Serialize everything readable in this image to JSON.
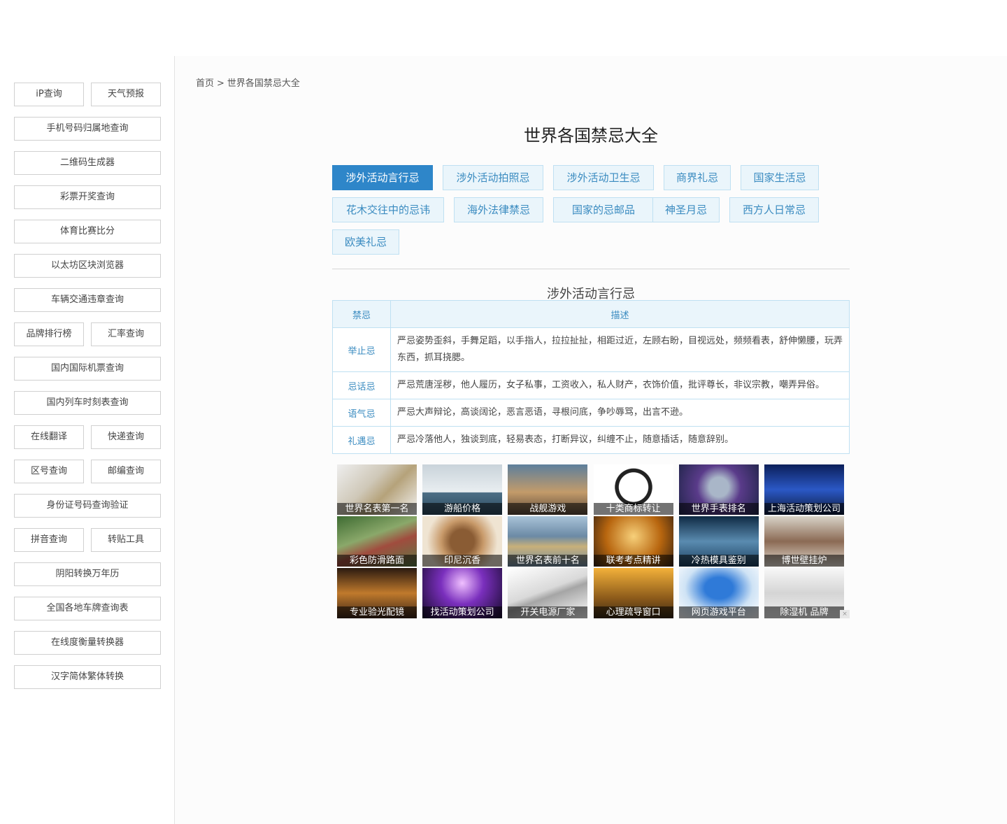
{
  "sidebar": {
    "rows": [
      [
        {
          "label": "iP查询"
        },
        {
          "label": "天气预报"
        }
      ],
      [
        {
          "label": "手机号码归属地查询"
        }
      ],
      [
        {
          "label": "二维码生成器"
        }
      ],
      [
        {
          "label": "彩票开奖查询"
        }
      ],
      [
        {
          "label": "体育比赛比分"
        }
      ],
      [
        {
          "label": "以太坊区块浏览器"
        }
      ],
      [
        {
          "label": "车辆交通违章查询"
        }
      ],
      [
        {
          "label": "品牌排行榜"
        },
        {
          "label": "汇率查询"
        }
      ],
      [
        {
          "label": "国内国际机票查询"
        }
      ],
      [
        {
          "label": "国内列车时刻表查询"
        }
      ],
      [
        {
          "label": "在线翻译"
        },
        {
          "label": "快递查询"
        }
      ],
      [
        {
          "label": "区号查询"
        },
        {
          "label": "邮编查询"
        }
      ],
      [
        {
          "label": "身份证号码查询验证"
        }
      ],
      [
        {
          "label": "拼音查询"
        },
        {
          "label": "转贴工具"
        }
      ],
      [
        {
          "label": "阴阳转换万年历"
        }
      ],
      [
        {
          "label": "全国各地车牌查询表"
        }
      ],
      [
        {
          "label": "在线度衡量转换器"
        }
      ],
      [
        {
          "label": "汉字简体繁体转换"
        }
      ]
    ]
  },
  "breadcrumb": {
    "home": "首页",
    "separator": ">",
    "current": "世界各国禁忌大全"
  },
  "page_title": "世界各国禁忌大全",
  "tags": [
    {
      "label": "涉外活动言行忌",
      "active": true
    },
    {
      "label": "涉外活动拍照忌"
    },
    {
      "label": "涉外活动卫生忌"
    },
    {
      "label": "商界礼忌"
    },
    {
      "label": "国家生活忌"
    },
    {
      "label": "花木交往中的忌讳"
    },
    {
      "label": "海外法律禁忌"
    },
    {
      "label": "国家的忌邮品"
    },
    {
      "label": "神圣月忌"
    },
    {
      "label": "西方人日常忌"
    },
    {
      "label": "欧美礼忌"
    }
  ],
  "section_title": "涉外活动言行忌",
  "table": {
    "headers": [
      "禁忌",
      "描述"
    ],
    "rows": [
      {
        "key": "举止忌",
        "desc": "严忌姿势歪斜，手舞足蹈，以手指人，拉拉扯扯，相距过近，左顾右盼，目视远处，频频看表，舒伸懒腰，玩弄东西，抓耳挠腮。"
      },
      {
        "key": "忌话忌",
        "desc": "严忌荒唐淫秽，他人履历，女子私事，工资收入，私人财产，衣饰价值，批评尊长，非议宗教，嘲弄异俗。"
      },
      {
        "key": "语气忌",
        "desc": "严忌大声辩论，高谈阔论，恶言恶语，寻根问底，争吵辱骂，出言不逊。"
      },
      {
        "key": "礼遇忌",
        "desc": "严忌冷落他人，独谈到底，轻易表态，打断异议，纠缠不止，随意插话，随意辞别。"
      }
    ]
  },
  "ads": [
    {
      "caption": "世界名表第一名",
      "icon": "watch-image"
    },
    {
      "caption": "游船价格",
      "icon": "boat-image"
    },
    {
      "caption": "战舰游戏",
      "icon": "warship-image"
    },
    {
      "caption": "十类商标转让",
      "icon": "trademark-image"
    },
    {
      "caption": "世界手表排名",
      "icon": "watch-image"
    },
    {
      "caption": "上海活动策划公司",
      "icon": "event-image"
    },
    {
      "caption": "彩色防滑路面",
      "icon": "road-image"
    },
    {
      "caption": "印尼沉香",
      "icon": "beads-image"
    },
    {
      "caption": "世界名表前十名",
      "icon": "watch-image"
    },
    {
      "caption": "联考考点精讲",
      "icon": "study-image"
    },
    {
      "caption": "冷热模具鉴别",
      "icon": "machine-image"
    },
    {
      "caption": "博世壁挂炉",
      "icon": "worker-image"
    },
    {
      "caption": "专业验光配镜",
      "icon": "glasses-image"
    },
    {
      "caption": "找活动策划公司",
      "icon": "concert-image"
    },
    {
      "caption": "开关电源厂家",
      "icon": "power-supply-image"
    },
    {
      "caption": "心理疏导窗口",
      "icon": "room-image"
    },
    {
      "caption": "网页游戏平台",
      "icon": "games-logo-image"
    },
    {
      "caption": "除湿机 品牌",
      "icon": "dehumidifier-image"
    }
  ],
  "ad_close": "×"
}
